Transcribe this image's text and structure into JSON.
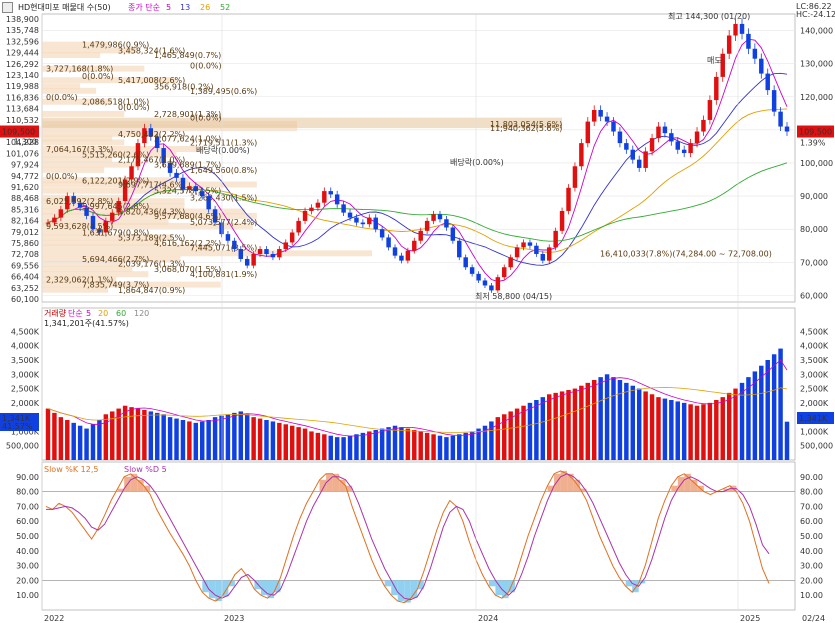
{
  "toolbar": {
    "icon_name": "window-icon"
  },
  "price_panel": {
    "title": "HD현대미포 매물대 수(50)",
    "legend": [
      {
        "label": "종가 단순",
        "color": "#cc00cc"
      },
      {
        "label": "5",
        "color": "#cc00cc"
      },
      {
        "label": "13",
        "color": "#3333cc"
      },
      {
        "label": "26",
        "color": "#e0a000"
      },
      {
        "label": "52",
        "color": "#33aa33"
      }
    ],
    "lc": "LC:86.22",
    "hc": "HC:-24.12",
    "current_price": "109,500",
    "current_pct": "1.39%",
    "left_current": "109,500",
    "left_vol_tag": "1,300",
    "high_annot": "최고 144,300 (01/20)",
    "low_annot": "최저 58,800 (04/15)",
    "ex_div_1": "배당락(0.00%)",
    "ex_div_2": "배당락(0.00%)",
    "ma_label": "매도",
    "right_pct_tag": "1.39%"
  },
  "volume_panel": {
    "legend": [
      {
        "label": "거래량",
        "color": "#cc0000"
      },
      {
        "label": "단순",
        "color": "#cc00cc"
      },
      {
        "label": "5",
        "color": "#cc00cc"
      },
      {
        "label": "20",
        "color": "#e0a000"
      },
      {
        "label": "60",
        "color": "#33aa33"
      },
      {
        "label": "120",
        "color": "#888888"
      }
    ],
    "last_value": "1,341,201주(41.57%)",
    "left_tags": [
      "1,341K",
      "41.57%"
    ],
    "right_tag": "1,341K"
  },
  "stoch_panel": {
    "legend": [
      {
        "label": "Slow %K 12,5",
        "color": "#e07020"
      },
      {
        "label": "Slow %D 5",
        "color": "#aa33aa"
      }
    ]
  },
  "x_axis": {
    "labels": [
      "2022",
      "2023",
      "2024",
      "2025",
      "02/24"
    ]
  },
  "chart_data": [
    {
      "type": "candlestick",
      "title": "HD현대미포 매물대 수(50)",
      "y_ticks_left": [
        "138,900",
        "135,748",
        "132,596",
        "129,444",
        "126,292",
        "123,140",
        "119,988",
        "116,836",
        "113,684",
        "110,532",
        "107,380",
        "104,228",
        "101,076",
        "97,924",
        "94,772",
        "91,620",
        "88,468",
        "85,316",
        "82,164",
        "79,012",
        "75,860",
        "72,708",
        "69,556",
        "66,404",
        "63,252",
        "60,100"
      ],
      "y_ticks_right": [
        "140,000",
        "130,000",
        "120,000",
        "110,000",
        "100,000",
        "90,000",
        "80,000",
        "70,000",
        "60,000"
      ],
      "ylim": [
        58000,
        145000
      ],
      "closes": [
        82000,
        83500,
        86000,
        90000,
        88000,
        86500,
        84000,
        80000,
        79000,
        82500,
        85000,
        88500,
        95000,
        99000,
        106000,
        110500,
        108000,
        104500,
        100000,
        97000,
        95500,
        92000,
        93000,
        91500,
        90000,
        86000,
        82000,
        78500,
        76500,
        74000,
        71000,
        69000,
        72500,
        74000,
        72500,
        71500,
        74000,
        76000,
        79000,
        82500,
        85500,
        86500,
        88000,
        91500,
        90500,
        87500,
        85000,
        83500,
        82000,
        81500,
        83500,
        80000,
        77500,
        74500,
        72000,
        70500,
        73500,
        76500,
        79500,
        82500,
        84500,
        83000,
        80500,
        76500,
        71500,
        68500,
        66500,
        64500,
        63000,
        61500,
        65500,
        68500,
        71500,
        74500,
        76000,
        75000,
        72500,
        70500,
        74500,
        79500,
        85500,
        92500,
        99000,
        106000,
        112500,
        116000,
        114000,
        112500,
        109500,
        106000,
        104000,
        101000,
        98500,
        103500,
        107500,
        111000,
        109000,
        106500,
        104000,
        103000,
        106000,
        109500,
        113000,
        119000,
        126000,
        133000,
        138500,
        142000,
        139000,
        134500,
        131500,
        127000,
        122000,
        115500,
        111000,
        109500
      ],
      "volume_kshares": [
        1800,
        1650,
        1500,
        1400,
        1300,
        1200,
        1100,
        1250,
        1400,
        1600,
        1700,
        1800,
        1900,
        1850,
        1800,
        1750,
        1700,
        1650,
        1600,
        1500,
        1450,
        1400,
        1350,
        1300,
        1350,
        1400,
        1500,
        1550,
        1600,
        1650,
        1700,
        1600,
        1500,
        1450,
        1400,
        1350,
        1300,
        1250,
        1200,
        1150,
        1100,
        1000,
        950,
        900,
        850,
        800,
        800,
        850,
        900,
        950,
        1000,
        1050,
        1100,
        1150,
        1200,
        1150,
        1100,
        1050,
        1000,
        950,
        900,
        850,
        800,
        850,
        900,
        950,
        1000,
        1100,
        1200,
        1350,
        1500,
        1600,
        1700,
        1800,
        1900,
        2000,
        2100,
        2200,
        2300,
        2350,
        2400,
        2450,
        2500,
        2600,
        2700,
        2800,
        2900,
        3000,
        2900,
        2800,
        2700,
        2600,
        2500,
        2400,
        2300,
        2200,
        2150,
        2100,
        2050,
        2000,
        1950,
        1900,
        1950,
        2000,
        2100,
        2200,
        2350,
        2500,
        2700,
        2900,
        3100,
        3300,
        3500,
        3700,
        3900,
        1341
      ],
      "volume_ticks": [
        "4,500K",
        "4,000K",
        "3,500K",
        "3,000K",
        "2,500K",
        "2,000K",
        "1,500K",
        "1,000K",
        "500,000"
      ],
      "volume_profile": [
        {
          "price": 138900,
          "label": ""
        },
        {
          "price": 135748,
          "label": "1,479,986(0.9%)"
        },
        {
          "price": 134000,
          "label": "3,458,324(1.6%)"
        },
        {
          "price": 132596,
          "label": "1,465,849(0.7%)"
        },
        {
          "price": 129444,
          "label": "0(0.0%)"
        },
        {
          "price": 128500,
          "label": "3,727,168(1.8%)"
        },
        {
          "price": 126292,
          "label": "0(0.0%)"
        },
        {
          "price": 125000,
          "label": "5,417,008(2.6%)"
        },
        {
          "price": 123140,
          "label": "356,918(0.2%)"
        },
        {
          "price": 121800,
          "label": "1,389,495(0.6%)"
        },
        {
          "price": 119988,
          "label": "0(0.0%)"
        },
        {
          "price": 118500,
          "label": "2,086,518(1.0%)"
        },
        {
          "price": 116836,
          "label": "0(0.0%)"
        },
        {
          "price": 114800,
          "label": "2,728,901(1.3%)"
        },
        {
          "price": 113684,
          "label": "0(0.0%)"
        },
        {
          "price": 111800,
          "label": "11,803,054(5.6%)"
        },
        {
          "price": 110532,
          "label": "11,940,362(5.6%)"
        },
        {
          "price": 108800,
          "label": "4,750,432(2.2%)"
        },
        {
          "price": 107380,
          "label": "2,077,624(1.0%)"
        },
        {
          "price": 106200,
          "label": "2,719,511(1.3%)"
        },
        {
          "price": 104228,
          "label": "7,064,167(3.3%)"
        },
        {
          "price": 102500,
          "label": "5,515,260(2.6%)"
        },
        {
          "price": 101076,
          "label": "2,175,467(1.0%)"
        },
        {
          "price": 99500,
          "label": "3,629,689(1.7%)"
        },
        {
          "price": 97924,
          "label": "1,649,560(0.8%)"
        },
        {
          "price": 96000,
          "label": "0(0.0%)"
        },
        {
          "price": 94772,
          "label": "6,122,201(2.9%)"
        },
        {
          "price": 93500,
          "label": "9,697,717(4.6%)"
        },
        {
          "price": 91620,
          "label": "5,324,578(2.5%)"
        },
        {
          "price": 89500,
          "label": "3,263,430(1.5%)"
        },
        {
          "price": 88468,
          "label": "6,025,592(2.8%)"
        },
        {
          "price": 87000,
          "label": "5,997,645(2.8%)"
        },
        {
          "price": 85316,
          "label": "9,820,436(4.3%)"
        },
        {
          "price": 84000,
          "label": "9,577,680(4.6%)"
        },
        {
          "price": 82164,
          "label": "5,073,577(2.4%)"
        },
        {
          "price": 81000,
          "label": "9,593,628(4.5%)"
        },
        {
          "price": 79012,
          "label": "1,631,679(0.8%)"
        },
        {
          "price": 77500,
          "label": "5,373,189(2.5%)"
        },
        {
          "price": 75860,
          "label": "4,616,162(2.2%)"
        },
        {
          "price": 74500,
          "label": "7,445,071(3.5%)"
        },
        {
          "price": 72708,
          "label": "16,410,033(7.8%)(74,284.00 ~ 72,708.00)"
        },
        {
          "price": 71000,
          "label": "5,694,466(2.7%)"
        },
        {
          "price": 69556,
          "label": "2,039,176(1.3%)"
        },
        {
          "price": 68000,
          "label": "3,068,070(1.5%)"
        },
        {
          "price": 66404,
          "label": "4,100,881(1.9%)"
        },
        {
          "price": 64800,
          "label": "2,329,062(1.1%)"
        },
        {
          "price": 63252,
          "label": "7,835,749(3.7%)"
        },
        {
          "price": 61700,
          "label": "1,864,847(0.9%)"
        },
        {
          "price": 60100,
          "label": ""
        }
      ],
      "highlight_band": [
        110532,
        113684
      ],
      "high": 144300,
      "low": 58800
    },
    {
      "type": "line",
      "title": "Slow %K 12,5 / Slow %D 5",
      "ylim": [
        0,
        100
      ],
      "y_ticks": [
        "90.00",
        "80.00",
        "70.00",
        "60.00",
        "50.00",
        "40.00",
        "30.00",
        "20.00",
        "10.00"
      ],
      "reference_lines": [
        80,
        20
      ],
      "series": [
        {
          "name": "Slow %K 12,5",
          "values": [
            70,
            68,
            72,
            70,
            66,
            60,
            54,
            48,
            55,
            64,
            74,
            82,
            90,
            92,
            88,
            84,
            78,
            68,
            60,
            52,
            45,
            38,
            30,
            20,
            12,
            8,
            6,
            9,
            16,
            24,
            28,
            22,
            14,
            10,
            8,
            12,
            22,
            36,
            50,
            62,
            72,
            80,
            88,
            92,
            92,
            88,
            84,
            70,
            58,
            46,
            34,
            24,
            16,
            10,
            6,
            5,
            8,
            14,
            26,
            40,
            54,
            66,
            74,
            70,
            60,
            46,
            34,
            24,
            16,
            10,
            8,
            12,
            22,
            36,
            50,
            62,
            74,
            84,
            92,
            94,
            92,
            88,
            82,
            74,
            62,
            50,
            40,
            30,
            22,
            16,
            12,
            18,
            30,
            46,
            62,
            74,
            84,
            90,
            92,
            88,
            84,
            80,
            78,
            80,
            82,
            84,
            80,
            72,
            60,
            44,
            28,
            18
          ]
        },
        {
          "name": "Slow %D 5",
          "values": [
            68,
            68,
            69,
            70,
            69,
            66,
            62,
            56,
            54,
            58,
            66,
            74,
            82,
            88,
            90,
            88,
            84,
            78,
            70,
            62,
            54,
            46,
            38,
            30,
            22,
            14,
            10,
            8,
            10,
            16,
            22,
            24,
            20,
            15,
            11,
            10,
            14,
            24,
            36,
            48,
            60,
            70,
            78,
            86,
            90,
            90,
            88,
            82,
            72,
            60,
            48,
            38,
            28,
            20,
            12,
            8,
            7,
            9,
            16,
            28,
            42,
            56,
            66,
            70,
            68,
            60,
            48,
            38,
            28,
            20,
            14,
            10,
            14,
            24,
            36,
            50,
            62,
            74,
            84,
            90,
            92,
            90,
            86,
            80,
            72,
            62,
            52,
            42,
            32,
            24,
            18,
            16,
            22,
            34,
            48,
            62,
            74,
            82,
            88,
            90,
            88,
            85,
            82,
            80,
            80,
            82,
            82,
            78,
            70,
            58,
            44,
            38
          ]
        }
      ]
    }
  ]
}
